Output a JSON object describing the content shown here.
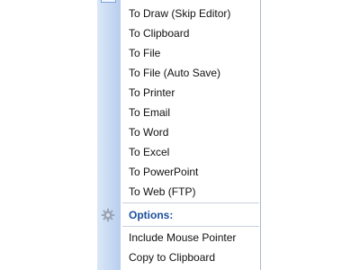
{
  "menu": {
    "items": [
      {
        "label": "To Draw (Skip Editor)"
      },
      {
        "label": "To Clipboard"
      },
      {
        "label": "To File"
      },
      {
        "label": "To File (Auto Save)"
      },
      {
        "label": "To Printer"
      },
      {
        "label": "To Email"
      },
      {
        "label": "To Word"
      },
      {
        "label": "To Excel"
      },
      {
        "label": "To PowerPoint"
      },
      {
        "label": "To Web (FTP)"
      }
    ],
    "options_header": {
      "label": "Options:",
      "icon": "gear-icon"
    },
    "option_items": [
      {
        "label": "Include Mouse Pointer"
      },
      {
        "label": "Copy to Clipboard"
      }
    ]
  },
  "colors": {
    "gutter": "#c8daf3",
    "header_text": "#1a4f9c",
    "item_text": "#111111"
  }
}
